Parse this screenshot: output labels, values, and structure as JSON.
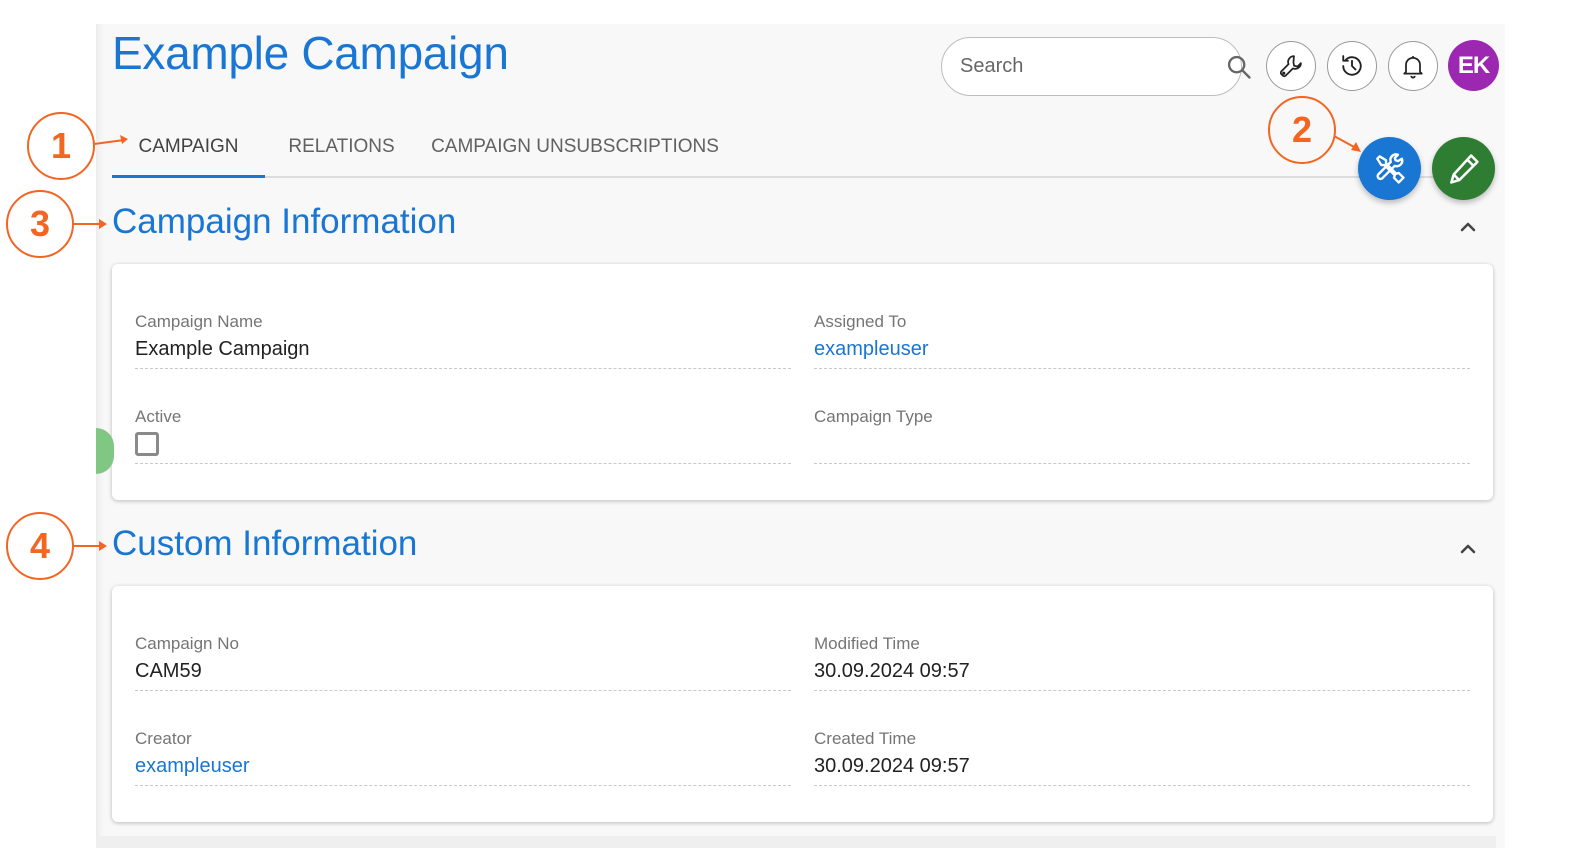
{
  "page": {
    "title": "Example Campaign"
  },
  "header": {
    "search_placeholder": "Search",
    "icons": [
      "search-icon",
      "wrench-icon",
      "history-icon",
      "bell-icon"
    ],
    "avatar_initials": "EK",
    "avatar_color": "#9c27b0"
  },
  "tabs": [
    {
      "label": "CAMPAIGN",
      "active": true
    },
    {
      "label": "RELATIONS",
      "active": false
    },
    {
      "label": "CAMPAIGN UNSUBSCRIPTIONS",
      "active": false
    }
  ],
  "actions": {
    "tools_button_color": "#1976d2",
    "edit_button_color": "#2e7d32"
  },
  "sections": [
    {
      "title": "Campaign Information",
      "fields": [
        {
          "label": "Campaign Name",
          "value": "Example Campaign",
          "type": "text"
        },
        {
          "label": "Assigned To",
          "value": "exampleuser",
          "type": "link"
        },
        {
          "label": "Active",
          "value": "unchecked",
          "type": "checkbox"
        },
        {
          "label": "Campaign Type",
          "value": "",
          "type": "text"
        }
      ]
    },
    {
      "title": "Custom Information",
      "fields": [
        {
          "label": "Campaign No",
          "value": "CAM59",
          "type": "text"
        },
        {
          "label": "Modified Time",
          "value": "30.09.2024 09:57",
          "type": "text"
        },
        {
          "label": "Creator",
          "value": "exampleuser",
          "type": "link"
        },
        {
          "label": "Created Time",
          "value": "30.09.2024 09:57",
          "type": "text"
        }
      ]
    }
  ],
  "annotations": [
    {
      "number": "1",
      "target": "Campaign tab"
    },
    {
      "number": "2",
      "target": "Tools button"
    },
    {
      "number": "3",
      "target": "Campaign Information section"
    },
    {
      "number": "4",
      "target": "Custom Information section"
    }
  ],
  "colors": {
    "accent": "#1976d2",
    "annotation": "#f26522",
    "link": "#1976d2"
  }
}
